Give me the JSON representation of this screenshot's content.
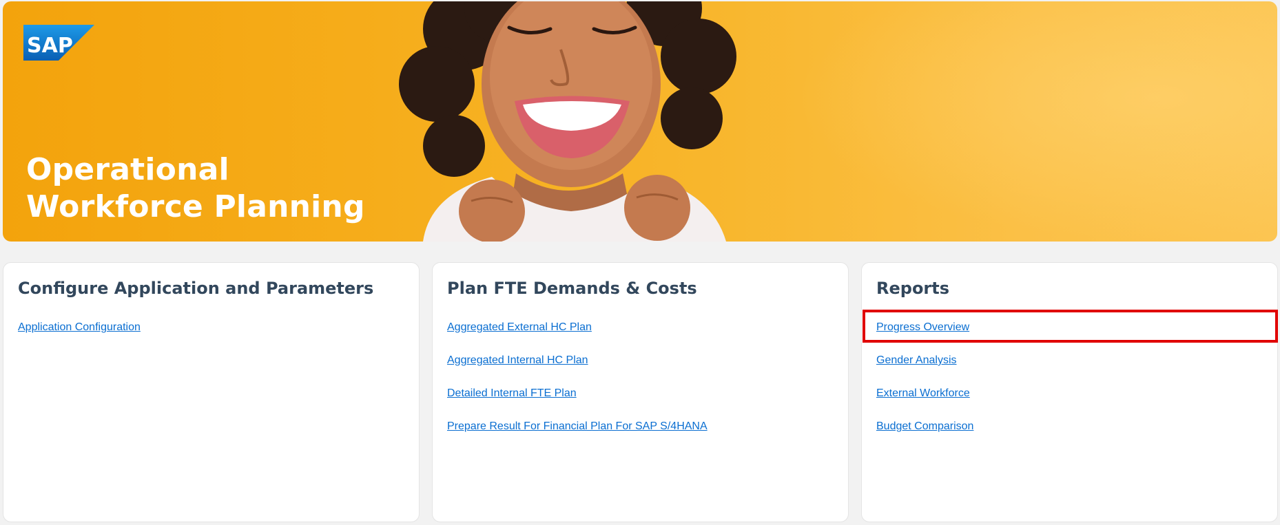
{
  "colors": {
    "hero_background": "#f6ad1b",
    "title_text": "#32475c",
    "link": "#0a6ed1",
    "highlight": "#e00000",
    "sap_blue": "#1b7fd4"
  },
  "hero": {
    "logo_text": "SAP",
    "title_line1": "Operational",
    "title_line2": "Workforce Planning"
  },
  "cards": [
    {
      "title": "Configure Application and Parameters",
      "links": [
        "Application Configuration"
      ]
    },
    {
      "title": "Plan FTE Demands & Costs",
      "links": [
        "Aggregated External HC Plan",
        "Aggregated Internal HC Plan",
        "Detailed Internal FTE Plan",
        "Prepare Result For Financial Plan For SAP S/4HANA"
      ]
    },
    {
      "title": "Reports",
      "links": [
        "Progress Overview",
        "Gender Analysis",
        "External Workforce",
        "Budget Comparison"
      ]
    }
  ],
  "highlighted_link": "Progress Overview"
}
